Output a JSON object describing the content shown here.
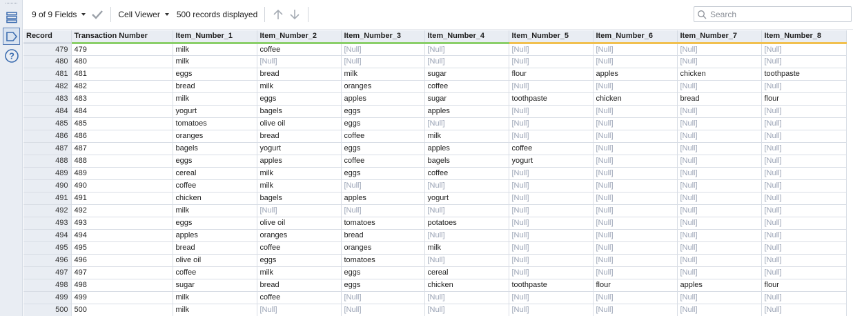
{
  "toolbar": {
    "fields_label": "9 of 9 Fields",
    "viewer_label": "Cell Viewer",
    "records_label": "500 records displayed",
    "search_placeholder": "Search"
  },
  "columns": [
    {
      "label": "Record",
      "status": "none"
    },
    {
      "label": "Transaction Number",
      "status": "ok"
    },
    {
      "label": "Item_Number_1",
      "status": "ok"
    },
    {
      "label": "Item_Number_2",
      "status": "ok"
    },
    {
      "label": "Item_Number_3",
      "status": "ok"
    },
    {
      "label": "Item_Number_4",
      "status": "ok"
    },
    {
      "label": "Item_Number_5",
      "status": "warn"
    },
    {
      "label": "Item_Number_6",
      "status": "warn"
    },
    {
      "label": "Item_Number_7",
      "status": "warn"
    },
    {
      "label": "Item_Number_8",
      "status": "warn"
    }
  ],
  "status_colors": {
    "ok": "#8bcf6a",
    "warn": "#f1c04f",
    "null_text": "#9aa3b5"
  },
  "null_token": "[Null]",
  "rows": [
    [
      "479",
      "479",
      "milk",
      "coffee",
      "[Null]",
      "[Null]",
      "[Null]",
      "[Null]",
      "[Null]",
      "[Null]"
    ],
    [
      "480",
      "480",
      "milk",
      "[Null]",
      "[Null]",
      "[Null]",
      "[Null]",
      "[Null]",
      "[Null]",
      "[Null]"
    ],
    [
      "481",
      "481",
      "eggs",
      "bread",
      "milk",
      "sugar",
      "flour",
      "apples",
      "chicken",
      "toothpaste"
    ],
    [
      "482",
      "482",
      "bread",
      "milk",
      "oranges",
      "coffee",
      "[Null]",
      "[Null]",
      "[Null]",
      "[Null]"
    ],
    [
      "483",
      "483",
      "milk",
      "eggs",
      "apples",
      "sugar",
      "toothpaste",
      "chicken",
      "bread",
      "flour"
    ],
    [
      "484",
      "484",
      "yogurt",
      "bagels",
      "eggs",
      "apples",
      "[Null]",
      "[Null]",
      "[Null]",
      "[Null]"
    ],
    [
      "485",
      "485",
      "tomatoes",
      "olive oil",
      "eggs",
      "[Null]",
      "[Null]",
      "[Null]",
      "[Null]",
      "[Null]"
    ],
    [
      "486",
      "486",
      "oranges",
      "bread",
      "coffee",
      "milk",
      "[Null]",
      "[Null]",
      "[Null]",
      "[Null]"
    ],
    [
      "487",
      "487",
      "bagels",
      "yogurt",
      "eggs",
      "apples",
      "coffee",
      "[Null]",
      "[Null]",
      "[Null]"
    ],
    [
      "488",
      "488",
      "eggs",
      "apples",
      "coffee",
      "bagels",
      "yogurt",
      "[Null]",
      "[Null]",
      "[Null]"
    ],
    [
      "489",
      "489",
      "cereal",
      "milk",
      "eggs",
      "coffee",
      "[Null]",
      "[Null]",
      "[Null]",
      "[Null]"
    ],
    [
      "490",
      "490",
      "coffee",
      "milk",
      "[Null]",
      "[Null]",
      "[Null]",
      "[Null]",
      "[Null]",
      "[Null]"
    ],
    [
      "491",
      "491",
      "chicken",
      "bagels",
      "apples",
      "yogurt",
      "[Null]",
      "[Null]",
      "[Null]",
      "[Null]"
    ],
    [
      "492",
      "492",
      "milk",
      "[Null]",
      "[Null]",
      "[Null]",
      "[Null]",
      "[Null]",
      "[Null]",
      "[Null]"
    ],
    [
      "493",
      "493",
      "eggs",
      "olive oil",
      "tomatoes",
      "potatoes",
      "[Null]",
      "[Null]",
      "[Null]",
      "[Null]"
    ],
    [
      "494",
      "494",
      "apples",
      "oranges",
      "bread",
      "[Null]",
      "[Null]",
      "[Null]",
      "[Null]",
      "[Null]"
    ],
    [
      "495",
      "495",
      "bread",
      "coffee",
      "oranges",
      "milk",
      "[Null]",
      "[Null]",
      "[Null]",
      "[Null]"
    ],
    [
      "496",
      "496",
      "olive oil",
      "eggs",
      "tomatoes",
      "[Null]",
      "[Null]",
      "[Null]",
      "[Null]",
      "[Null]"
    ],
    [
      "497",
      "497",
      "coffee",
      "milk",
      "eggs",
      "cereal",
      "[Null]",
      "[Null]",
      "[Null]",
      "[Null]"
    ],
    [
      "498",
      "498",
      "sugar",
      "bread",
      "eggs",
      "chicken",
      "toothpaste",
      "flour",
      "apples",
      "flour"
    ],
    [
      "499",
      "499",
      "milk",
      "coffee",
      "[Null]",
      "[Null]",
      "[Null]",
      "[Null]",
      "[Null]",
      "[Null]"
    ],
    [
      "500",
      "500",
      "milk",
      "[Null]",
      "[Null]",
      "[Null]",
      "[Null]",
      "[Null]",
      "[Null]",
      "[Null]"
    ]
  ]
}
